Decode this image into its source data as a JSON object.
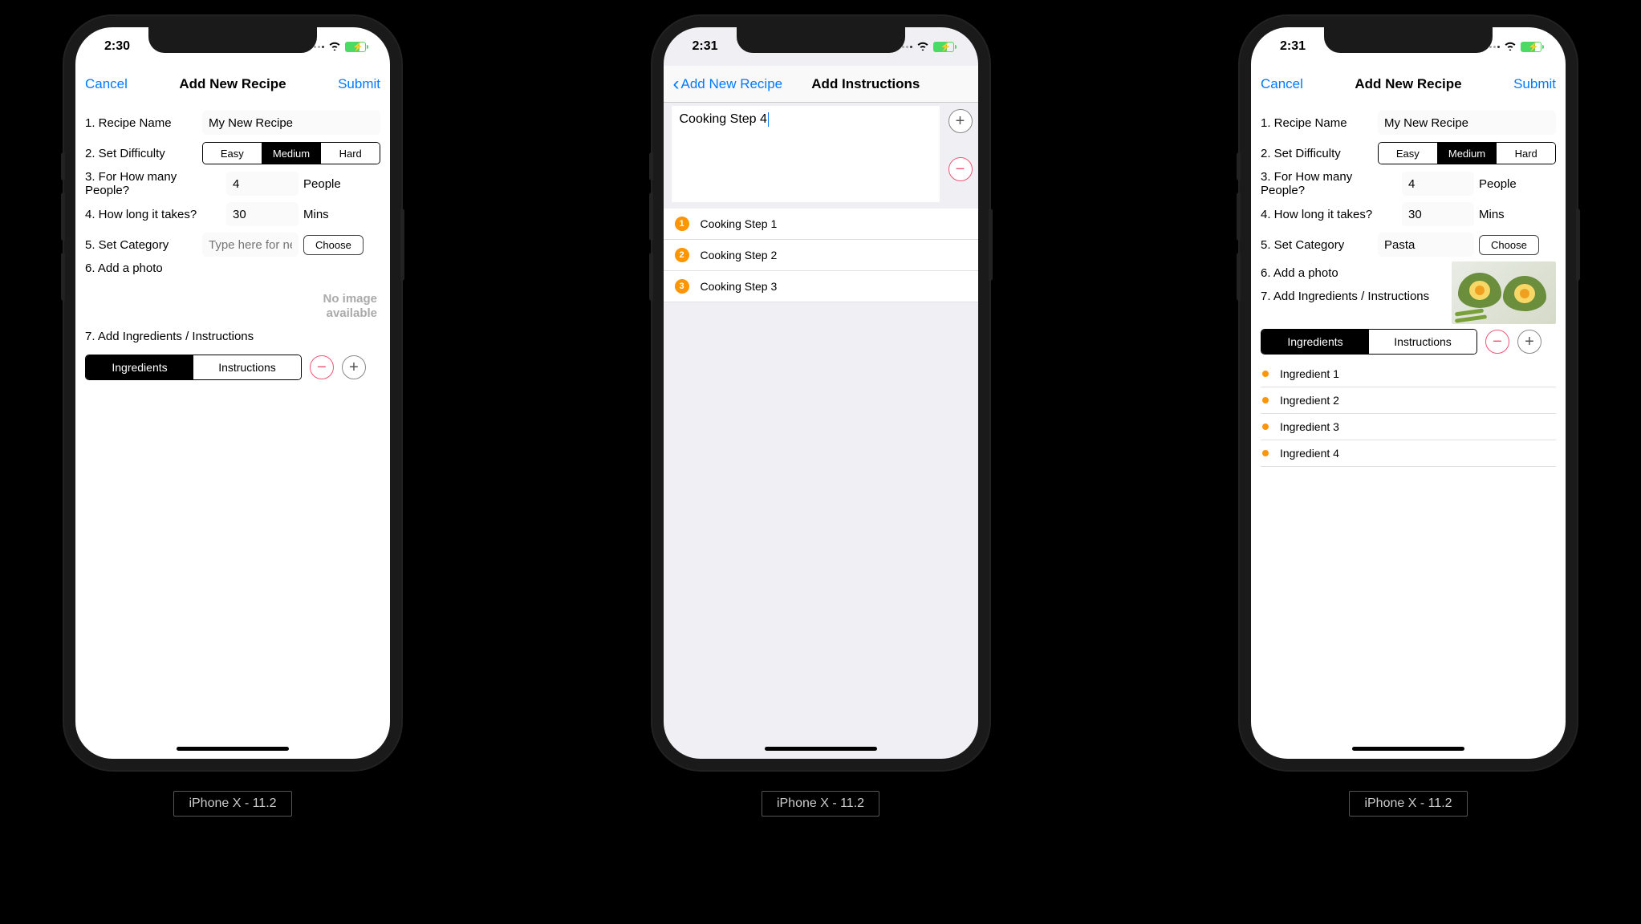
{
  "device_label": "iPhone X - 11.2",
  "screens": [
    {
      "time": "2:30",
      "nav": {
        "left": "Cancel",
        "title": "Add New Recipe",
        "right": "Submit"
      },
      "form": {
        "l1": "1. Recipe Name",
        "v1": "My New Recipe",
        "l2": "2. Set Difficulty",
        "diff": [
          "Easy",
          "Medium",
          "Hard"
        ],
        "diff_sel": "Medium",
        "l3": "3. For How many People?",
        "v3": "4",
        "s3": "People",
        "l4": "4. How long it takes?",
        "v4": "30",
        "s4": "Mins",
        "l5": "5. Set Category",
        "v5_placeholder": "Type here for new",
        "choose": "Choose",
        "l6": "6. Add a photo",
        "no_image": "No image\navailable",
        "l7": "7. Add Ingredients / Instructions",
        "tabs": [
          "Ingredients",
          "Instructions"
        ],
        "tab_sel": "Ingredients"
      }
    },
    {
      "time": "2:31",
      "nav": {
        "back": "Add New Recipe",
        "title": "Add Instructions"
      },
      "compose": "Cooking Step 4",
      "steps": [
        "Cooking Step 1",
        "Cooking Step 2",
        "Cooking Step 3"
      ]
    },
    {
      "time": "2:31",
      "nav": {
        "left": "Cancel",
        "title": "Add New Recipe",
        "right": "Submit"
      },
      "form": {
        "l1": "1. Recipe Name",
        "v1": "My New Recipe",
        "l2": "2. Set Difficulty",
        "diff": [
          "Easy",
          "Medium",
          "Hard"
        ],
        "diff_sel": "Medium",
        "l3": "3. For How many People?",
        "v3": "4",
        "s3": "People",
        "l4": "4. How long it takes?",
        "v4": "30",
        "s4": "Mins",
        "l5": "5. Set Category",
        "v5": "Pasta",
        "choose": "Choose",
        "l6": "6. Add a photo",
        "l7": "7. Add Ingredients / Instructions",
        "tabs": [
          "Ingredients",
          "Instructions"
        ],
        "tab_sel": "Ingredients",
        "ingredients": [
          "Ingredient 1",
          "Ingredient 2",
          "Ingredient 3",
          "Ingredient 4"
        ]
      }
    }
  ]
}
